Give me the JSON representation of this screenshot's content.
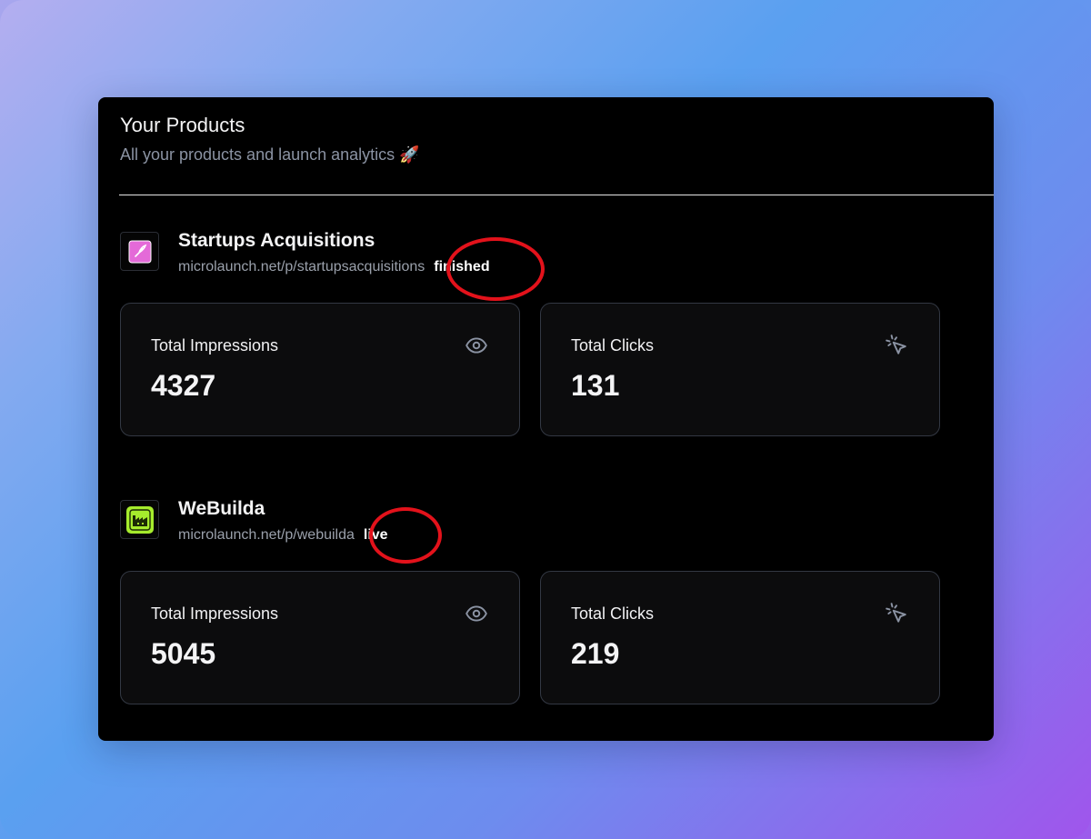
{
  "header": {
    "title": "Your Products",
    "subtitle": "All your products and launch analytics 🚀"
  },
  "products": [
    {
      "name": "Startups Acquisitions",
      "url": "microlaunch.net/p/startupsacquisitions",
      "status": "finished",
      "logo_icon": "rocket-icon",
      "stats": [
        {
          "label": "Total Impressions",
          "value": "4327",
          "icon": "eye-icon"
        },
        {
          "label": "Total Clicks",
          "value": "131",
          "icon": "cursor-click-icon"
        }
      ]
    },
    {
      "name": "WeBuilda",
      "url": "microlaunch.net/p/webuilda",
      "status": "live",
      "logo_icon": "factory-icon",
      "stats": [
        {
          "label": "Total Impressions",
          "value": "5045",
          "icon": "eye-icon"
        },
        {
          "label": "Total Clicks",
          "value": "219",
          "icon": "cursor-click-icon"
        }
      ]
    }
  ],
  "colors": {
    "panel_background": "#000000",
    "card_border": "#333843",
    "highlight_circle": "#e3121b",
    "logo_pink": "#e46ad8",
    "logo_green": "#a6ec2d"
  }
}
